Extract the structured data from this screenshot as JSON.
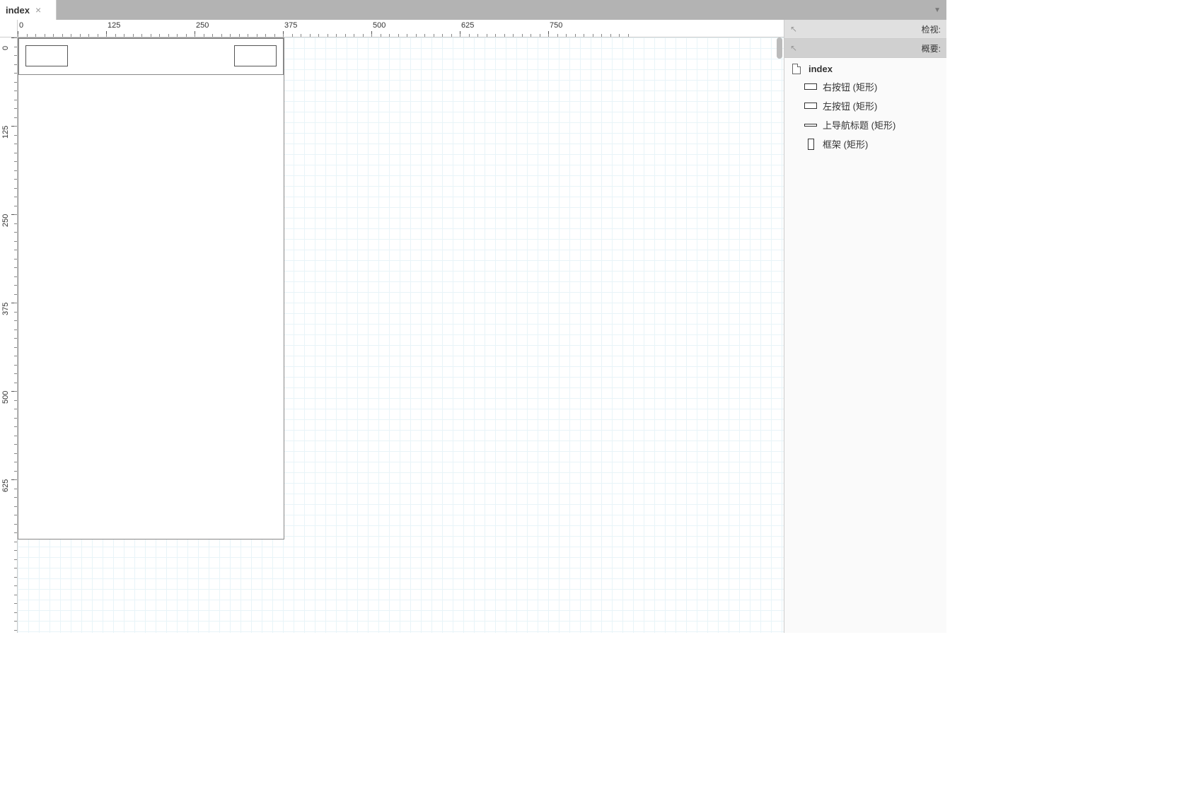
{
  "tab": {
    "label": "index"
  },
  "panels": {
    "inspect": "检视:",
    "outline": "概要:"
  },
  "outline": {
    "root": "index",
    "items": [
      "右按钮 (矩形)",
      "左按钮 (矩形)",
      "上导航标题 (矩形)",
      "框架 (矩形)"
    ]
  },
  "ruler": {
    "h_marks": [
      0,
      125,
      250,
      375,
      500,
      625,
      750
    ],
    "v_marks": [
      0,
      125,
      250,
      375,
      500,
      625
    ]
  }
}
